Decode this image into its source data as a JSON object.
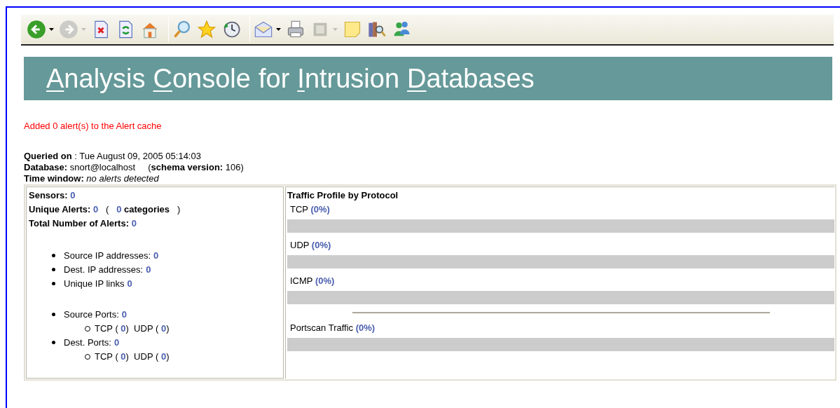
{
  "toolbar": {
    "groups": [
      [
        {
          "kind": "back",
          "disabled": false,
          "dropdown": true
        },
        {
          "kind": "forward",
          "disabled": true,
          "dropdown": true
        },
        {
          "kind": "stop",
          "disabled": false,
          "dropdown": false
        },
        {
          "kind": "refresh",
          "disabled": false,
          "dropdown": false
        },
        {
          "kind": "home",
          "disabled": false,
          "dropdown": false
        }
      ],
      [
        {
          "kind": "search",
          "disabled": false,
          "dropdown": false
        },
        {
          "kind": "favorites",
          "disabled": false,
          "dropdown": false
        },
        {
          "kind": "history",
          "disabled": false,
          "dropdown": false
        }
      ],
      [
        {
          "kind": "mail",
          "disabled": false,
          "dropdown": true
        },
        {
          "kind": "print",
          "disabled": false,
          "dropdown": false
        },
        {
          "kind": "fullscreen",
          "disabled": true,
          "dropdown": true
        },
        {
          "kind": "note",
          "disabled": false,
          "dropdown": false
        },
        {
          "kind": "research",
          "disabled": false,
          "dropdown": false
        },
        {
          "kind": "messenger",
          "disabled": false,
          "dropdown": false
        }
      ]
    ]
  },
  "banner": {
    "title_words": [
      {
        "text": "Analysis",
        "underline_first": true
      },
      {
        "text": "Console",
        "underline_first": true
      },
      {
        "text": "for",
        "underline_first": false
      },
      {
        "text": "Intrusion",
        "underline_first": true
      },
      {
        "text": "Databases",
        "underline_first": true
      }
    ]
  },
  "message": "Added 0 alert(s) to the Alert cache",
  "query_info": [
    [
      {
        "text": "Queried on",
        "kind": "label"
      },
      {
        "text": " : Tue August 09, 2005 05:14:03",
        "kind": "text"
      }
    ],
    [
      {
        "text": "Database:",
        "kind": "label"
      },
      {
        "text": " snort@localhost     (",
        "kind": "text"
      },
      {
        "text": "schema version:",
        "kind": "label"
      },
      {
        "text": " 106)",
        "kind": "text"
      }
    ],
    [
      {
        "text": "Time window:",
        "kind": "label"
      },
      {
        "text": " no alerts detected",
        "kind": "note"
      }
    ]
  ],
  "summary": {
    "stats": [
      [
        {
          "text": "Sensors:",
          "kind": "label"
        },
        {
          "text": " 0",
          "kind": "value"
        }
      ],
      [
        {
          "text": "Unique Alerts:",
          "kind": "label"
        },
        {
          "text": " 0",
          "kind": "value"
        },
        {
          "text": "   (   ",
          "kind": "text"
        },
        {
          "text": "0",
          "kind": "value"
        },
        {
          "text": " categories",
          "kind": "label"
        },
        {
          "text": "   )",
          "kind": "text"
        }
      ],
      [
        {
          "text": "Total Number of Alerts:",
          "kind": "label"
        },
        {
          "text": " 0",
          "kind": "value"
        }
      ]
    ],
    "ip_items": [
      {
        "label": "Source IP addresses:",
        "value": "0"
      },
      {
        "label": "Dest. IP addresses:",
        "value": "0"
      },
      {
        "label": "Unique IP links",
        "value": "0"
      }
    ],
    "port_items": [
      {
        "label": "Source Ports:",
        "value": "0",
        "sub": [
          {
            "text": "TCP ( ",
            "kind": "text"
          },
          {
            "text": "0",
            "kind": "value"
          },
          {
            "text": ")  UDP ( ",
            "kind": "text"
          },
          {
            "text": "0",
            "kind": "value"
          },
          {
            "text": ")",
            "kind": "text"
          }
        ]
      },
      {
        "label": "Dest. Ports:",
        "value": "0",
        "sub": [
          {
            "text": "TCP ( ",
            "kind": "text"
          },
          {
            "text": "0",
            "kind": "value"
          },
          {
            "text": ")  UDP ( ",
            "kind": "text"
          },
          {
            "text": "0",
            "kind": "value"
          },
          {
            "text": ")",
            "kind": "text"
          }
        ]
      }
    ]
  },
  "traffic": {
    "title": "Traffic Profile by Protocol",
    "protocols": [
      {
        "name": "TCP",
        "percent": "(0%)",
        "level": 0
      },
      {
        "name": "UDP",
        "percent": "(0%)",
        "level": 0
      },
      {
        "name": "ICMP",
        "percent": "(0%)",
        "level": 0
      }
    ],
    "portscan": {
      "name": "Portscan Traffic",
      "percent": "(0%)",
      "level": 0
    }
  }
}
